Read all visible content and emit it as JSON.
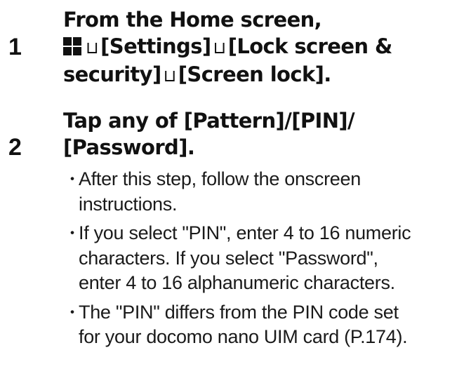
{
  "steps": [
    {
      "number": "1",
      "title_lines": {
        "l1": "From the Home screen,",
        "l2_icon": "apps-grid-icon",
        "l2_arrow1": "⊔",
        "l2_a": "[Settings]",
        "l2_arrow2": "⊔",
        "l2_b": "[Lock screen &",
        "l3_a": "security]",
        "l3_arrow": "⊔",
        "l3_b": "[Screen lock]."
      }
    },
    {
      "number": "2",
      "title_lines": {
        "l1": "Tap any of [Pattern]/[PIN]/",
        "l2": "[Password]."
      },
      "bullet_symbol": "・",
      "bullets": [
        {
          "lines": [
            "After this step, follow the onscreen",
            "instructions."
          ]
        },
        {
          "lines": [
            "If you select \"PIN\", enter 4 to 16 numeric",
            "characters. If you select \"Password\",",
            "enter 4 to 16 alphanumeric characters."
          ]
        },
        {
          "lines": [
            "The \"PIN\" differs from the PIN code set",
            "for your docomo nano UIM card (P.174)."
          ]
        }
      ]
    }
  ],
  "colors": {
    "text": "#111111",
    "icon": "#111111"
  }
}
